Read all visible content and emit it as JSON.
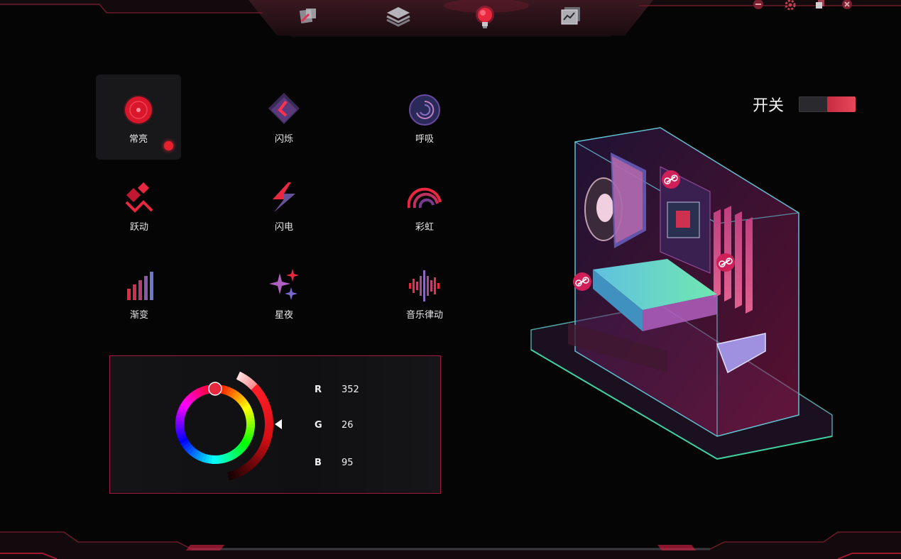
{
  "topnav": {
    "items": [
      {
        "id": "device",
        "icon": "device-icon"
      },
      {
        "id": "layers",
        "icon": "layers-icon"
      },
      {
        "id": "lighting",
        "icon": "bulb-icon",
        "active": true
      },
      {
        "id": "monitor",
        "icon": "monitor-icon"
      }
    ]
  },
  "window_controls": [
    {
      "id": "minimize",
      "icon": "minimize-icon"
    },
    {
      "id": "settings",
      "icon": "gear-icon"
    },
    {
      "id": "restore",
      "icon": "restore-icon"
    },
    {
      "id": "close",
      "icon": "close-icon"
    }
  ],
  "effects": [
    {
      "id": "static",
      "label": "常亮",
      "icon": "static-light-icon",
      "selected": true
    },
    {
      "id": "flash",
      "label": "闪烁",
      "icon": "flash-icon"
    },
    {
      "id": "breath",
      "label": "呼吸",
      "icon": "breath-icon"
    },
    {
      "id": "jump",
      "label": "跃动",
      "icon": "jump-icon"
    },
    {
      "id": "lightning",
      "label": "闪电",
      "icon": "lightning-icon"
    },
    {
      "id": "rainbow",
      "label": "彩虹",
      "icon": "rainbow-icon"
    },
    {
      "id": "gradient",
      "label": "渐变",
      "icon": "gradient-bars-icon"
    },
    {
      "id": "starry",
      "label": "星夜",
      "icon": "stars-icon"
    },
    {
      "id": "music",
      "label": "音乐律动",
      "icon": "sound-wave-icon"
    }
  ],
  "color": {
    "r_label": "R",
    "r_value": "352",
    "g_label": "G",
    "g_value": "26",
    "b_label": "B",
    "b_value": "95"
  },
  "power": {
    "label": "开关",
    "on": true
  },
  "colors": {
    "accent": "#e8202e",
    "panel_border": "#a01840"
  }
}
